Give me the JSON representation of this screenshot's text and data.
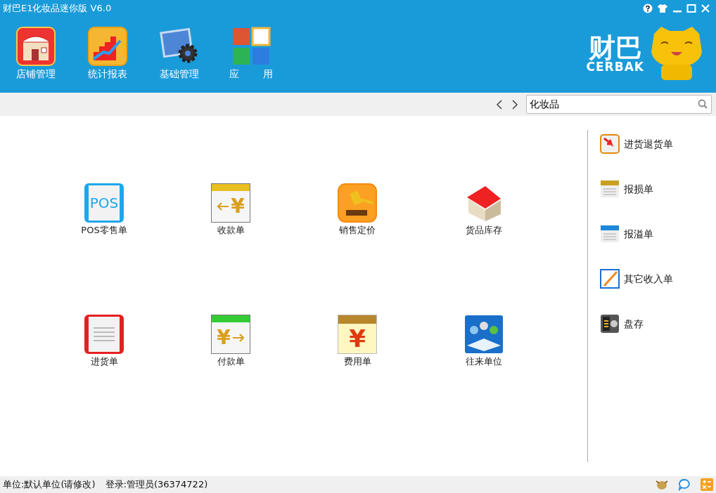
{
  "window": {
    "title": "财巴E1化妆品迷你版 V6.0"
  },
  "toolbar": [
    {
      "kind": "store",
      "label": "店铺管理"
    },
    {
      "kind": "chart",
      "label": "统计报表"
    },
    {
      "kind": "settings",
      "label": "基础管理"
    },
    {
      "kind": "apps",
      "label": "应用"
    }
  ],
  "logo": {
    "chinese": "财巴",
    "latin": "CERBAK"
  },
  "search": {
    "value": "化妆品"
  },
  "main_items": [
    {
      "kind": "pos",
      "label": "POS零售单",
      "icon_text": "POS"
    },
    {
      "kind": "receive",
      "label": "收款单",
      "icon_text": "¥"
    },
    {
      "kind": "gavel",
      "label": "销售定价"
    },
    {
      "kind": "warehouse",
      "label": "货品库存"
    },
    {
      "kind": "purchase",
      "label": "进货单"
    },
    {
      "kind": "pay",
      "label": "付款单",
      "icon_text": "¥"
    },
    {
      "kind": "expense",
      "label": "费用单",
      "icon_text": "¥"
    },
    {
      "kind": "people",
      "label": "往来单位"
    }
  ],
  "side_items": [
    {
      "kind": "return",
      "label": "进货退货单"
    },
    {
      "kind": "loss",
      "label": "报损单"
    },
    {
      "kind": "overflow",
      "label": "报溢单"
    },
    {
      "kind": "income",
      "label": "其它收入单"
    },
    {
      "kind": "safe",
      "label": "盘存"
    }
  ],
  "status_bar": {
    "unit": "单位:默认单位(请修改)",
    "login": "登录:管理员(36374722)"
  }
}
